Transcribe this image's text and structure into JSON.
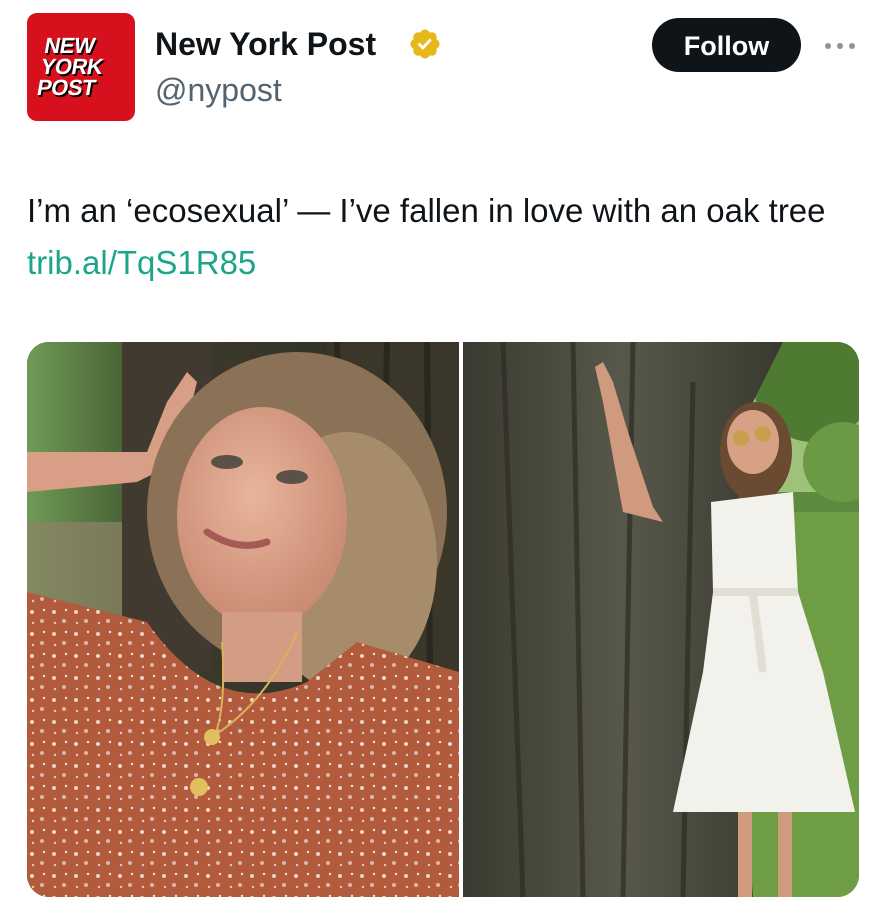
{
  "account": {
    "display_name": "New York Post",
    "handle": "@nypost",
    "avatar_logo_lines": [
      "NEW",
      "YORK",
      "POST"
    ],
    "verified_badge": "gold-verified-badge-icon",
    "brand_color": "#d6101c",
    "badge_color": "#e8b71a"
  },
  "actions": {
    "follow_label": "Follow",
    "more_icon": "more-dots-icon"
  },
  "tweet": {
    "text": "I’m an ‘ecosexual’ — I’ve fallen in love with an oak tree ",
    "link_text": "trib.al/TqS1R85",
    "link_color": "#1da58a"
  },
  "media": {
    "photo_count": 2
  }
}
